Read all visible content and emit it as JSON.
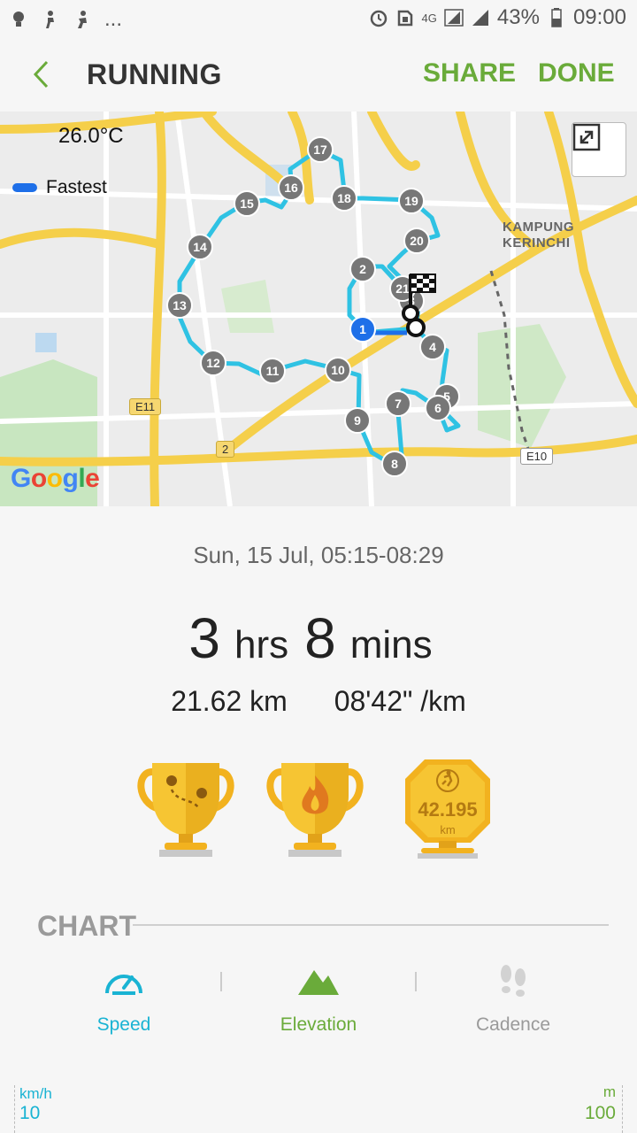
{
  "status_bar": {
    "battery_pct": "43%",
    "time": "09:00",
    "network": "4G",
    "overflow": "...",
    "icons": [
      "bulb-icon",
      "walk-icon",
      "run-icon",
      "alarm-icon",
      "nfc-icon",
      "signal-icon",
      "battery-icon"
    ]
  },
  "header": {
    "title": "RUNNING",
    "share_label": "SHARE",
    "done_label": "DONE"
  },
  "map": {
    "temperature": "26.0°C",
    "legend_label": "Fastest",
    "legend_color": "#1e6fe8",
    "route_color": "#29c6e6",
    "place_label": "KAMPUNG\nKERINCHI",
    "road_signs": [
      "E11",
      "2",
      "E10"
    ],
    "attribution": "Google",
    "km_markers": [
      "1",
      "2",
      "3",
      "4",
      "5",
      "6",
      "7",
      "8",
      "9",
      "10",
      "11",
      "12",
      "13",
      "14",
      "15",
      "16",
      "17",
      "18",
      "19",
      "20",
      "21"
    ]
  },
  "summary": {
    "date": "Sun, 15 Jul, 05:15-08:29",
    "hours": "3",
    "hours_unit": "hrs",
    "minutes": "8",
    "minutes_unit": "mins",
    "distance": "21.62 km",
    "pace": "08'42\" /km",
    "medal_value": "42.195",
    "medal_unit": "km"
  },
  "chart": {
    "title": "CHART",
    "tabs": [
      {
        "label": "Speed",
        "color": "#19b3d3"
      },
      {
        "label": "Elevation",
        "color": "#6aab3a"
      },
      {
        "label": "Cadence",
        "color": "#9a9a9a"
      }
    ],
    "left_axis_unit": "km/h",
    "left_axis_max": "10",
    "right_axis_unit": "m",
    "right_axis_max": "100"
  }
}
